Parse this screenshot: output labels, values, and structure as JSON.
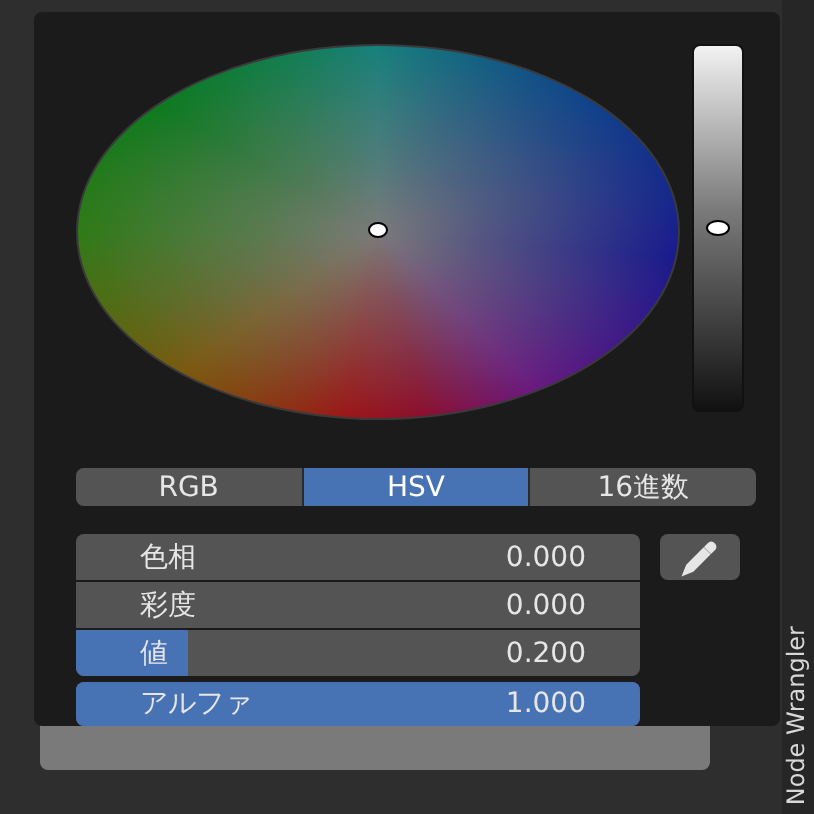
{
  "value_slider": {
    "level": 0.5
  },
  "modes": [
    {
      "label": "RGB",
      "selected": false
    },
    {
      "label": "HSV",
      "selected": true
    },
    {
      "label": "16進数",
      "selected": false
    }
  ],
  "fields": [
    {
      "label": "色相",
      "value": "0.000",
      "level": 0
    },
    {
      "label": "彩度",
      "value": "0.000",
      "level": 0
    },
    {
      "label": "値",
      "value": "0.200",
      "level": 0.2
    },
    {
      "label": "アルファ",
      "value": "1.000",
      "level": 1
    }
  ],
  "sidebar_tab": "Node Wrangler"
}
